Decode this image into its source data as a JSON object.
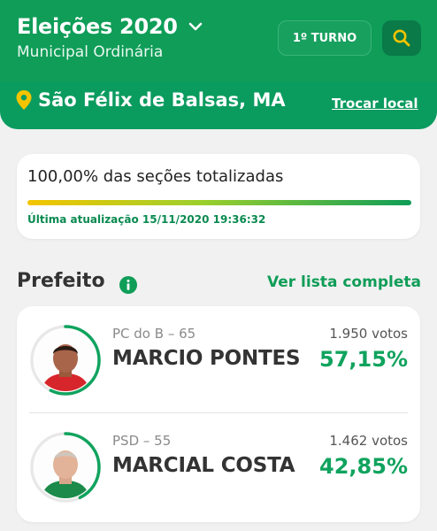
{
  "header": {
    "title": "Eleições 2020",
    "subtitle": "Municipal Ordinária",
    "turno_label": "1º TURNO",
    "location": "São Félix de Balsas, MA",
    "change_location_label": "Trocar local",
    "colors": {
      "primary": "#0f9d58",
      "accent": "#f5c400"
    }
  },
  "progress": {
    "title": "100,00% das seções totalizadas",
    "fraction": 1.0,
    "updated": "Última atualização 15/11/2020 19:36:32"
  },
  "section": {
    "title": "Prefeito",
    "link_label": "Ver lista completa"
  },
  "candidates": [
    {
      "party": "PC do B – 65",
      "name": "MARCIO PONTES",
      "votes": "1.950 votos",
      "percent": "57,15%",
      "share": 0.5715
    },
    {
      "party": "PSD – 55",
      "name": "MARCIAL COSTA",
      "votes": "1.462 votos",
      "percent": "42,85%",
      "share": 0.4285
    }
  ]
}
